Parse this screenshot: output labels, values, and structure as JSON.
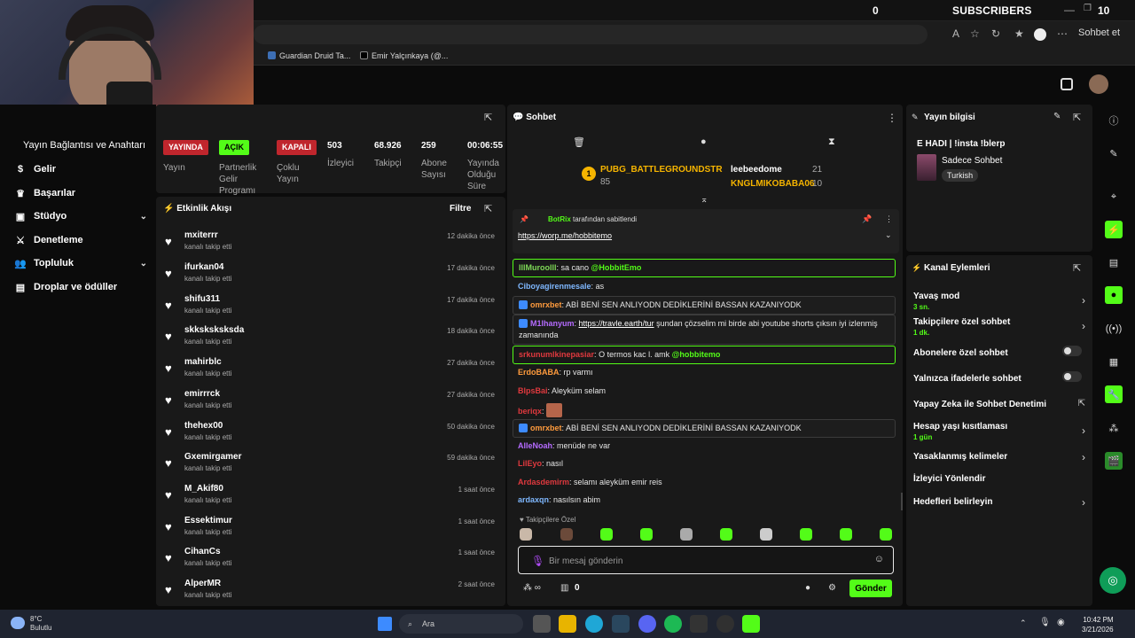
{
  "topbar": {
    "count": "0",
    "subscribers": "SUBSCRIBERS",
    "num": "10"
  },
  "browser": {
    "sohbet_et": "Sohbet et",
    "bookmarks": [
      "Guardian Druid Ta...",
      "Emir Yalçınkaya (@..."
    ]
  },
  "sidebar": {
    "key_item": "Yayın Bağlantısı ve Anahtarı",
    "items": [
      {
        "label": "Gelir",
        "icon": "dollar-icon"
      },
      {
        "label": "Başarılar",
        "icon": "trophy-icon"
      },
      {
        "label": "Stüdyo",
        "icon": "camera-icon"
      },
      {
        "label": "Denetleme",
        "icon": "sword-icon"
      },
      {
        "label": "Topluluk",
        "icon": "users-icon"
      },
      {
        "label": "Droplar ve ödüller",
        "icon": "gift-icon"
      }
    ]
  },
  "stats": {
    "yayin": {
      "badge": "YAYINDA",
      "label": "Yayın"
    },
    "partner": {
      "badge": "AÇIK",
      "label": "Partnerlik Gelir Programı"
    },
    "multi": {
      "badge": "KAPALI",
      "label": "Çoklu Yayın"
    },
    "viewers": {
      "value": "503",
      "label": "İzleyici"
    },
    "followers": {
      "value": "68.926",
      "label": "Takipçi"
    },
    "subs": {
      "value": "259",
      "label": "Abone Sayısı"
    },
    "duration": {
      "value": "00:06:55",
      "label": "Yayında Olduğu Süre"
    }
  },
  "feed": {
    "title": "Etkinlik Akışı",
    "filter": "Filtre",
    "rows": [
      {
        "name": "mxiterrr",
        "sub": "kanalı takip etti",
        "time": "12 dakika önce"
      },
      {
        "name": "ifurkan04",
        "sub": "kanalı takip etti",
        "time": "17 dakika önce"
      },
      {
        "name": "shifu311",
        "sub": "kanalı takip etti",
        "time": "17 dakika önce"
      },
      {
        "name": "skksksksksda",
        "sub": "kanalı takip etti",
        "time": "18 dakika önce"
      },
      {
        "name": "mahirblc",
        "sub": "kanalı takip etti",
        "time": "27 dakika önce"
      },
      {
        "name": "emirrrck",
        "sub": "kanalı takip etti",
        "time": "27 dakika önce"
      },
      {
        "name": "thehex00",
        "sub": "kanalı takip etti",
        "time": "50 dakika önce"
      },
      {
        "name": "Gxemirgamer",
        "sub": "kanalı takip etti",
        "time": "59 dakika önce"
      },
      {
        "name": "M_Akif80",
        "sub": "kanalı takip etti",
        "time": "1 saat önce"
      },
      {
        "name": "Essektimur",
        "sub": "kanalı takip etti",
        "time": "1 saat önce"
      },
      {
        "name": "CihanCs",
        "sub": "kanalı takip etti",
        "time": "1 saat önce"
      },
      {
        "name": "AlperMR",
        "sub": "kanalı takip etti",
        "time": "2 saat önce"
      }
    ]
  },
  "chat": {
    "title": "Sohbet",
    "leaderboard": [
      {
        "name": "PUBG_BATTLEGROUNDSTR",
        "value": "85"
      },
      {
        "name": "leebeedome",
        "value": "21"
      },
      {
        "name": "KNGLMIKOBABA06",
        "value": "10"
      }
    ],
    "leader_rank": "1",
    "pinned": {
      "by_user": "BotRix",
      "by_text": "tarafından sabitlendi",
      "link": "https://worp.me/hobbitemo"
    },
    "messages": [
      {
        "user": "lllMuroolll",
        "text": "sa cano ",
        "mention": "@HobbitEmo",
        "color": "#7ed957"
      },
      {
        "user": "Ciboyagirenmesale",
        "text": "as",
        "color": "#7fb8ff"
      },
      {
        "user": "omrxbet",
        "text": "ABİ BENİ SEN ANLIYODN DEDİKLERİNİ BASSAN KAZANIYODK",
        "color": "#ff9b3d"
      },
      {
        "user": "M1lhanyum",
        "link": "https://travle.earth/tur",
        "text": " şundan çözselim mi birde abi youtube shorts çıksın iyi izlenmiş zamanında",
        "color": "#b56bff"
      },
      {
        "user": "srkunumlkinepasiar",
        "text": "O termos kac l. amk ",
        "mention": "@hobbitemo",
        "color": "#e0393e"
      },
      {
        "user": "ErdoBABA",
        "text": "rp varmı",
        "color": "#ff9b3d"
      },
      {
        "user": "BlpsBai",
        "text": "Aleyküm selam",
        "color": "#e0393e"
      },
      {
        "user": "beriqx",
        "text": "",
        "color": "#e0393e"
      },
      {
        "user": "omrxbet",
        "text": "ABİ BENİ SEN ANLIYODN DEDİKLERİNİ BASSAN KAZANIYODK",
        "color": "#ff9b3d"
      },
      {
        "user": "AlleNoah",
        "text": "menüde ne var",
        "color": "#b56bff"
      },
      {
        "user": "LilEyo",
        "text": "nasıl",
        "color": "#e0393e"
      },
      {
        "user": "Ardasdemirm",
        "text": "selamı aleyküm emir reis",
        "color": "#e0393e"
      },
      {
        "user": "ardaxqn",
        "text": "nasılsın abim",
        "color": "#7fb8ff"
      }
    ],
    "follower_only": "Takipçilere Özel",
    "input_placeholder": "Bir mesaj gönderin",
    "send": "Gönder",
    "bottom_count": "0"
  },
  "info": {
    "title": "Yayın bilgisi",
    "stream_title": "E HADI | !insta !blerp",
    "category": "Sadece Sohbet",
    "tag": "Turkish"
  },
  "actions": {
    "title": "Kanal Eylemleri",
    "rows": [
      {
        "label": "Yavaş mod",
        "sub": "3 sn."
      },
      {
        "label": "Takipçilere özel sohbet",
        "sub": "1 dk."
      },
      {
        "label": "Abonelere özel sohbet",
        "sub": ""
      },
      {
        "label": "Yalnızca ifadelerle sohbet",
        "sub": ""
      },
      {
        "label": "Yapay Zeka ile Sohbet Denetimi",
        "sub": ""
      },
      {
        "label": "Hesap yaşı kısıtlaması",
        "sub": "1 gün"
      },
      {
        "label": "Yasaklanmış kelimeler",
        "sub": ""
      },
      {
        "label": "İzleyici Yönlendir",
        "sub": ""
      },
      {
        "label": "Hedefleri belirleyin",
        "sub": ""
      }
    ]
  },
  "taskbar": {
    "temp": "8°C",
    "weather": "Bulutlu",
    "search": "Ara",
    "time": "10:42 PM",
    "date": "3/21/2026"
  },
  "colors": {
    "accent": "#53fc18",
    "live_red": "#c0262d",
    "panel": "#191919"
  }
}
